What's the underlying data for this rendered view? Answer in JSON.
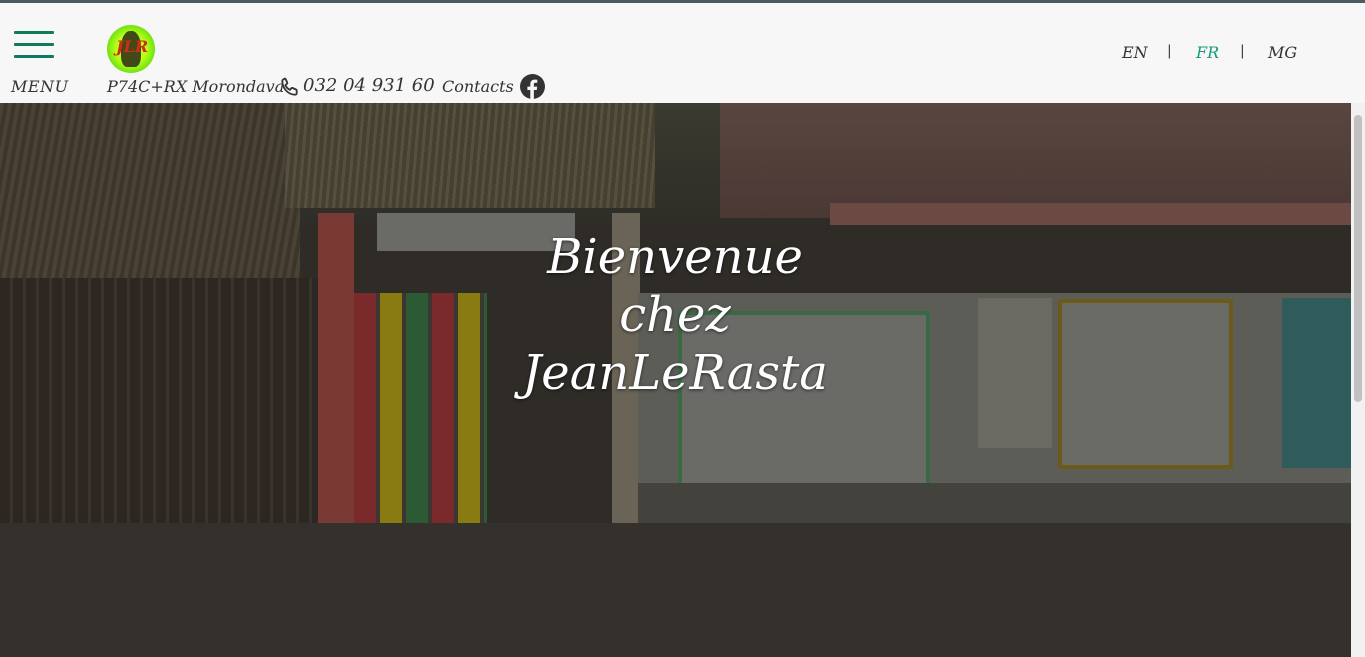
{
  "header": {
    "menu_label": "MENU",
    "address": "P74C+RX Morondava",
    "phone": "032 04 931 60",
    "contacts_label": "Contacts",
    "logo_text": "JLR"
  },
  "languages": [
    {
      "code": "EN",
      "active": false
    },
    {
      "code": "FR",
      "active": true
    },
    {
      "code": "MG",
      "active": false
    }
  ],
  "lang_separator": "|",
  "hero": {
    "line1": "Bienvenue",
    "line2": "chez",
    "line3": "JeanLeRasta"
  },
  "colors": {
    "accent": "#139c7a",
    "menu_bars": "#0f7a5e",
    "text": "#333333",
    "hero_text": "#ffffff"
  },
  "icons": [
    "menu-icon",
    "logo",
    "phone-icon",
    "facebook-icon"
  ]
}
